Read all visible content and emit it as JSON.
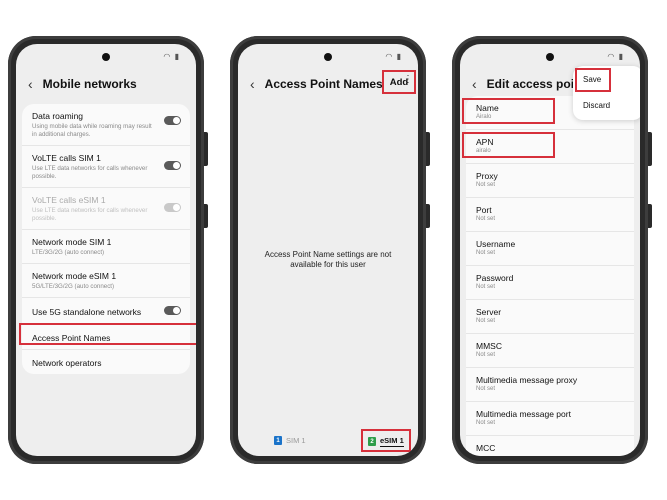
{
  "colors": {
    "highlight": "#d6303b",
    "sim1_badge": "#1a73c9",
    "sim2_badge": "#2e9e4a"
  },
  "phone1": {
    "title": "Mobile networks",
    "items": [
      {
        "title": "Data roaming",
        "subtitle": "Using mobile data while roaming may result in additional charges.",
        "toggle": "on"
      },
      {
        "title": "VoLTE calls SIM 1",
        "subtitle": "Use LTE data networks for calls whenever possible.",
        "toggle": "on"
      },
      {
        "title": "VoLTE calls eSIM 1",
        "subtitle": "Use LTE data networks for calls whenever possible.",
        "toggle": "disabled"
      },
      {
        "title": "Network mode SIM 1",
        "subtitle": "LTE/3G/2G (auto connect)"
      },
      {
        "title": "Network mode eSIM 1",
        "subtitle": "5G/LTE/3G/2G (auto connect)"
      },
      {
        "title": "Use 5G standalone networks",
        "toggle": "on"
      },
      {
        "title": "Access Point Names"
      },
      {
        "title": "Network operators"
      }
    ]
  },
  "phone2": {
    "title": "Access Point Names",
    "add_label": "Add",
    "message": "Access Point Name settings are not available for this user",
    "sim_tabs": [
      {
        "badge": "1",
        "label": "SIM 1",
        "selected": false
      },
      {
        "badge": "2",
        "label": "eSIM 1",
        "selected": true
      }
    ]
  },
  "phone3": {
    "title": "Edit access point",
    "menu": [
      "Save",
      "Discard"
    ],
    "fields": [
      {
        "label": "Name",
        "value": "Airalo"
      },
      {
        "label": "APN",
        "value": "airalo"
      },
      {
        "label": "Proxy",
        "value": "Not set"
      },
      {
        "label": "Port",
        "value": "Not set"
      },
      {
        "label": "Username",
        "value": "Not set"
      },
      {
        "label": "Password",
        "value": "Not set"
      },
      {
        "label": "Server",
        "value": "Not set"
      },
      {
        "label": "MMSC",
        "value": "Not set"
      },
      {
        "label": "Multimedia message proxy",
        "value": "Not set"
      },
      {
        "label": "Multimedia message port",
        "value": "Not set"
      },
      {
        "label": "MCC",
        "value": ""
      }
    ]
  }
}
